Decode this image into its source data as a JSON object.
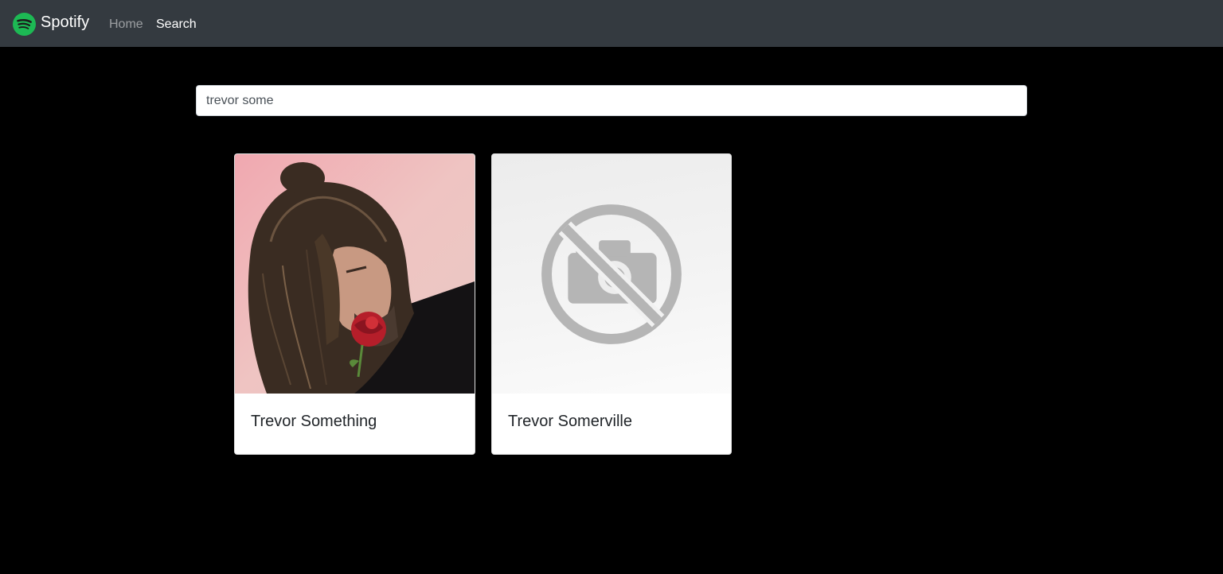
{
  "navbar": {
    "brand_name": "Spotify",
    "brand_icon": "spotify-logo-icon",
    "brand_color": "#1db954",
    "links": [
      {
        "label": "Home",
        "active": false
      },
      {
        "label": "Search",
        "active": true
      }
    ]
  },
  "search": {
    "value": "trevor some",
    "placeholder": ""
  },
  "results": [
    {
      "name": "Trevor Something",
      "image": "artist-photo"
    },
    {
      "name": "Trevor Somerville",
      "image": "no-image-placeholder-icon"
    }
  ],
  "colors": {
    "navbar_bg": "#343a40",
    "page_bg": "#000000",
    "card_bg": "#ffffff"
  }
}
